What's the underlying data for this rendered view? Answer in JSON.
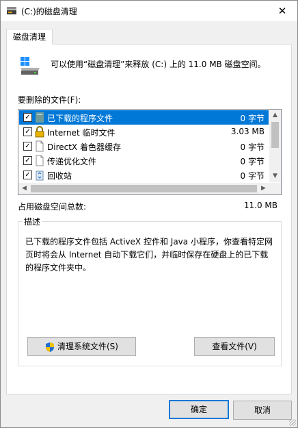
{
  "window": {
    "title": "(C:)的磁盘清理",
    "close_glyph": "✕"
  },
  "tab": {
    "label": "磁盘清理"
  },
  "summary": {
    "text": "可以使用“磁盘清理”来释放 (C:) 上的 11.0 MB 磁盘空间。"
  },
  "files": {
    "label": "要删除的文件(F):",
    "items": [
      {
        "name": "已下载的程序文件",
        "size": "0 字节",
        "checked": true,
        "selected": true,
        "icon": "program-files-icon"
      },
      {
        "name": "Internet 临时文件",
        "size": "3.03 MB",
        "checked": true,
        "selected": false,
        "icon": "lock-icon"
      },
      {
        "name": "DirectX 着色器缓存",
        "size": "0 字节",
        "checked": true,
        "selected": false,
        "icon": "document-icon"
      },
      {
        "name": "传递优化文件",
        "size": "0 字节",
        "checked": true,
        "selected": false,
        "icon": "document-icon"
      },
      {
        "name": "回收站",
        "size": "0 字节",
        "checked": true,
        "selected": false,
        "icon": "recycle-bin-icon"
      }
    ],
    "check_glyph": "✓"
  },
  "total": {
    "label": "占用磁盘空间总数:",
    "value": "11.0 MB"
  },
  "description": {
    "title": "描述",
    "text": "已下载的程序文件包括 ActiveX 控件和 Java 小程序，你查看特定网页时将会从 Internet 自动下载它们，并临时保存在硬盘上的已下载的程序文件夹中。"
  },
  "buttons": {
    "clean_system": "清理系统文件(S)",
    "view_files": "查看文件(V)",
    "ok": "确定",
    "cancel": "取消"
  },
  "colors": {
    "selection": "#0078d7",
    "panel": "#ffffff",
    "window": "#f0f0f0"
  }
}
